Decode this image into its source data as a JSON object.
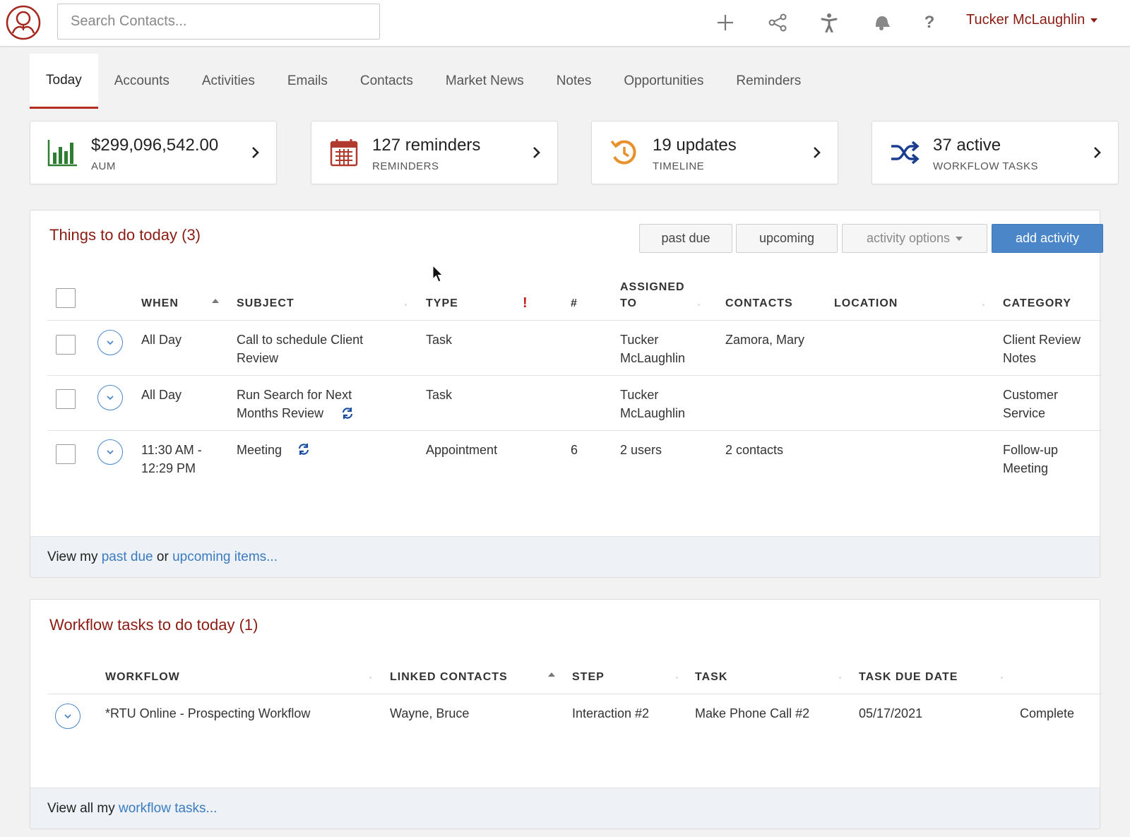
{
  "header": {
    "search_placeholder": "Search Contacts...",
    "user_name": "Tucker McLaughlin",
    "icons": [
      "add-icon",
      "share-icon",
      "accessibility-icon",
      "notifications-icon",
      "help-icon"
    ]
  },
  "tabs": [
    "Today",
    "Accounts",
    "Activities",
    "Emails",
    "Contacts",
    "Market News",
    "Notes",
    "Opportunities",
    "Reminders"
  ],
  "active_tab": "Today",
  "cards": [
    {
      "value": "$299,096,542.00",
      "label": "AUM",
      "icon": "bar-chart-icon"
    },
    {
      "value": "127 reminders",
      "label": "REMINDERS",
      "icon": "calendar-icon"
    },
    {
      "value": "19 updates",
      "label": "TIMELINE",
      "icon": "history-icon"
    },
    {
      "value": "37 active",
      "label": "WORKFLOW TASKS",
      "icon": "shuffle-icon"
    }
  ],
  "todo": {
    "title": "Things to do today (3)",
    "buttons": {
      "past_due": "past due",
      "upcoming": "upcoming",
      "activity_options": "activity options",
      "add_activity": "add activity"
    },
    "headers": {
      "when": "WHEN",
      "subject": "SUBJECT",
      "type": "TYPE",
      "priority": "!",
      "count": "#",
      "assigned_1": "ASSIGNED",
      "assigned_2": "TO",
      "contacts": "CONTACTS",
      "location": "LOCATION",
      "category": "CATEGORY"
    },
    "rows": [
      {
        "when_1": "All Day",
        "when_2": "",
        "subject_1": "Call to schedule Client",
        "subject_2": "Review",
        "recurring": false,
        "type": "Task",
        "count": "",
        "assigned_1": "Tucker",
        "assigned_2": "McLaughlin",
        "assigned_link": false,
        "contacts": "Zamora, Mary",
        "location": "",
        "category_1": "Client Review",
        "category_2": "Notes"
      },
      {
        "when_1": "All Day",
        "when_2": "",
        "subject_1": "Run Search for Next",
        "subject_2": "Months Review",
        "recurring": true,
        "type": "Task",
        "count": "",
        "assigned_1": "Tucker",
        "assigned_2": "McLaughlin",
        "assigned_link": false,
        "contacts": "",
        "location": "",
        "category_1": "Customer",
        "category_2": "Service"
      },
      {
        "when_1": "11:30 AM -",
        "when_2": "12:29 PM",
        "subject_1": "Meeting",
        "subject_2": "",
        "recurring": true,
        "type": "Appointment",
        "count": "6",
        "assigned_1": "2 users",
        "assigned_2": "",
        "assigned_link": true,
        "contacts": "2 contacts",
        "location": "",
        "category_1": "Follow-up",
        "category_2": "Meeting"
      }
    ],
    "footer": {
      "prefix": "View my ",
      "past_due": "past due",
      "middle": " or ",
      "upcoming": "upcoming items..."
    }
  },
  "workflow": {
    "title": "Workflow tasks to do today (1)",
    "headers": {
      "workflow": "WORKFLOW",
      "linked_contacts": "LINKED CONTACTS",
      "step": "STEP",
      "task": "TASK",
      "due_date": "TASK DUE DATE"
    },
    "rows": [
      {
        "workflow": "*RTU Online - Prospecting Workflow",
        "linked_contacts": "Wayne, Bruce",
        "step": "Interaction #2",
        "task": "Make Phone Call #2",
        "due_date": "05/17/2021",
        "action": "Complete"
      }
    ],
    "footer": {
      "prefix": "View all my ",
      "link": "workflow tasks..."
    }
  },
  "colors": {
    "brand_red": "#8b1c14",
    "link_blue": "#3b7cc0",
    "primary_button": "#4a86c8",
    "aum_green": "#2e7d32",
    "calendar_red": "#b03a2e",
    "timeline_orange": "#e8902a",
    "workflow_navy": "#1a3d8f"
  }
}
